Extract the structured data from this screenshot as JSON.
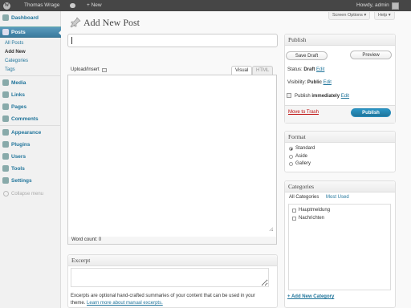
{
  "adminbar": {
    "site_name": "Thomas Wrage",
    "new_label": "+ New",
    "howdy": "Howdy, admin"
  },
  "sidebar": {
    "items": [
      {
        "label": "Dashboard",
        "icon": "dashboard-icon"
      },
      {
        "label": "Posts",
        "icon": "pin-icon"
      },
      {
        "label": "Media",
        "icon": "media-icon"
      },
      {
        "label": "Links",
        "icon": "links-icon"
      },
      {
        "label": "Pages",
        "icon": "pages-icon"
      },
      {
        "label": "Comments",
        "icon": "comments-icon"
      },
      {
        "label": "Appearance",
        "icon": "appearance-icon"
      },
      {
        "label": "Plugins",
        "icon": "plugins-icon"
      },
      {
        "label": "Users",
        "icon": "users-icon"
      },
      {
        "label": "Tools",
        "icon": "tools-icon"
      },
      {
        "label": "Settings",
        "icon": "settings-icon"
      }
    ],
    "submenu": [
      "All Posts",
      "Add New",
      "Categories",
      "Tags"
    ],
    "collapse_label": "Collapse menu"
  },
  "screen_options": "Screen Options",
  "help": "Help",
  "page_title": "Add New Post",
  "title_input": {
    "value": ""
  },
  "editor": {
    "upload_insert": "Upload/Insert",
    "tab_visual": "Visual",
    "tab_html": "HTML",
    "word_count": "Word count: 0"
  },
  "excerpt": {
    "title": "Excerpt",
    "help_text": "Excerpts are optional hand-crafted summaries of your content that can be used in your",
    "help_text2_prefix": "theme.",
    "help_link": "Learn more about manual excerpts."
  },
  "publish": {
    "title": "Publish",
    "save_draft": "Save Draft",
    "preview": "Preview",
    "status_label": "Status:",
    "status_value": "Draft",
    "visibility_label": "Visibility:",
    "visibility_value": "Public",
    "publish_label": "Publish",
    "publish_value": "immediately",
    "edit": "Edit",
    "move_to_trash": "Move to Trash",
    "publish_button": "Publish"
  },
  "format": {
    "title": "Format",
    "options": [
      "Standard",
      "Aside",
      "Gallery"
    ],
    "selected": "Standard"
  },
  "categories": {
    "title": "Categories",
    "tab_all": "All Categories",
    "tab_most_used": "Most Used",
    "items": [
      "Hauptmeldung",
      "Nachrichten"
    ],
    "add_new": "+ Add New Category"
  },
  "colors": {
    "adminbar": "#464646",
    "accent": "#21759b",
    "current_menu": "#4b8db0",
    "trash": "#bc0b0b"
  }
}
